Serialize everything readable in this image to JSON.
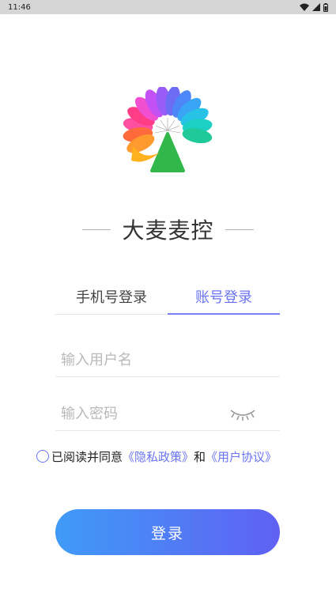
{
  "status_bar": {
    "time": "11:46"
  },
  "brand": {
    "title": "大麦麦控"
  },
  "tabs": [
    {
      "label": "手机号登录",
      "active": false
    },
    {
      "label": "账号登录",
      "active": true
    }
  ],
  "form": {
    "username_placeholder": "输入用户名",
    "password_placeholder": "输入密码"
  },
  "agreement": {
    "prefix": "已阅读并同意",
    "privacy_link": "《隐私政策》",
    "conjunction": "和",
    "user_link": "《用户协议》"
  },
  "login_button": {
    "label": "登录"
  },
  "colors": {
    "accent": "#6a74f2",
    "button_gradient_start": "#3f9bf7",
    "button_gradient_end": "#6060f3",
    "status_bar_bg": "#d6d6d6"
  },
  "icons": {
    "wifi": "wifi-icon",
    "signal": "signal-icon",
    "battery": "battery-icon",
    "password_visibility": "eye-closed-icon"
  }
}
